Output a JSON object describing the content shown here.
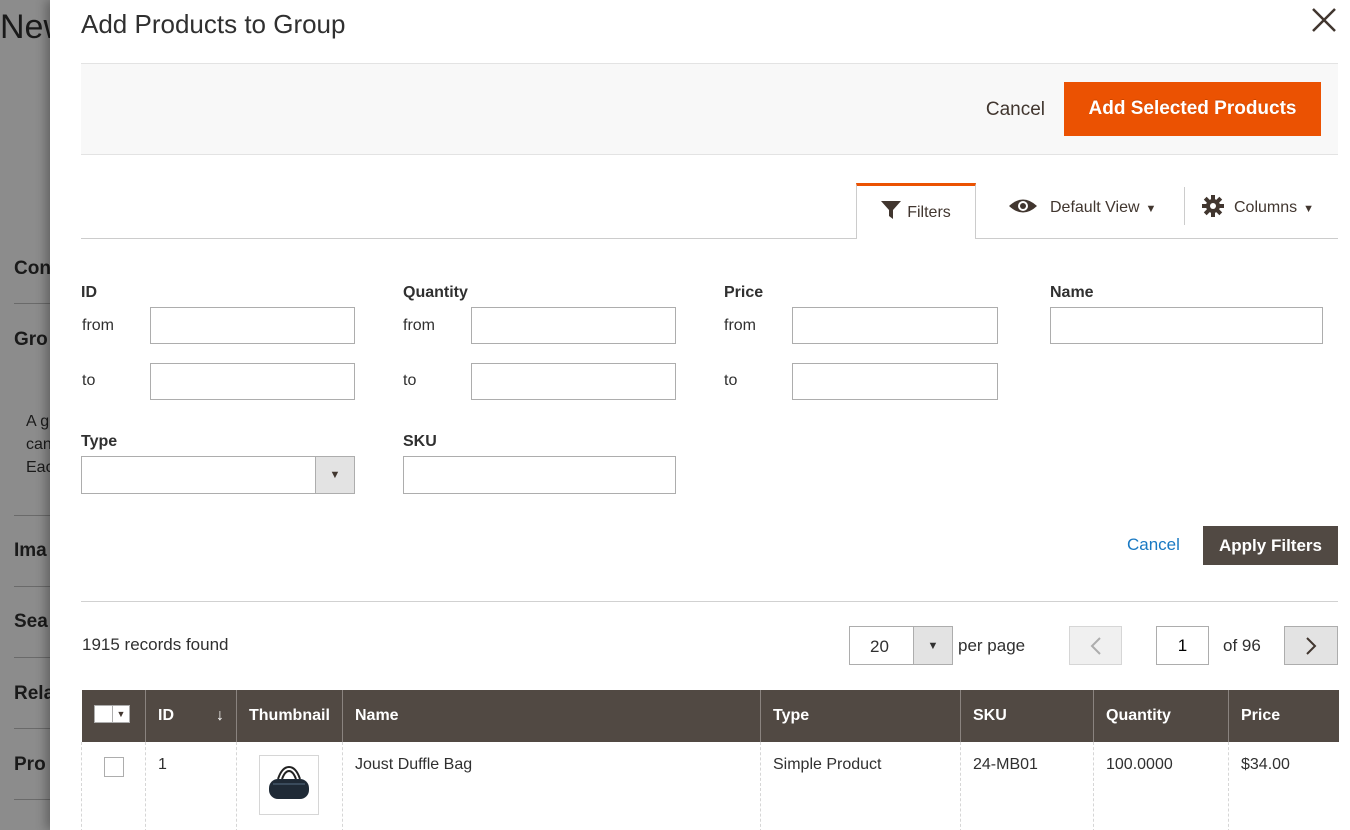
{
  "background": {
    "title": "New",
    "sections": [
      "Con",
      "Gro",
      "Ima",
      "Sea",
      "Rela",
      "Pro"
    ],
    "text_lines": [
      "A g",
      "can",
      "Eac"
    ]
  },
  "modal": {
    "title": "Add Products to Group",
    "actions": {
      "cancel": "Cancel",
      "add": "Add Selected Products"
    }
  },
  "toolbar": {
    "filters": "Filters",
    "view": "Default View",
    "columns": "Columns"
  },
  "filters": {
    "id": {
      "label": "ID",
      "from": "from",
      "to": "to"
    },
    "quantity": {
      "label": "Quantity",
      "from": "from",
      "to": "to"
    },
    "price": {
      "label": "Price",
      "from": "from",
      "to": "to"
    },
    "name": {
      "label": "Name"
    },
    "type": {
      "label": "Type",
      "value": ""
    },
    "sku": {
      "label": "SKU"
    },
    "cancel": "Cancel",
    "apply": "Apply Filters"
  },
  "grid": {
    "records": "1915 records found",
    "per_page_value": "20",
    "per_page_label": "per page",
    "page": "1",
    "of_pages": "of 96",
    "columns": [
      "ID",
      "Thumbnail",
      "Name",
      "Type",
      "SKU",
      "Quantity",
      "Price"
    ],
    "sort_indicator": "↓",
    "rows": [
      {
        "id": "1",
        "name": "Joust Duffle Bag",
        "type": "Simple Product",
        "sku": "24-MB01",
        "quantity": "100.0000",
        "price": "$34.00"
      }
    ]
  },
  "colors": {
    "accent": "#eb5202",
    "header_bg": "#514943",
    "link": "#1979c3"
  }
}
